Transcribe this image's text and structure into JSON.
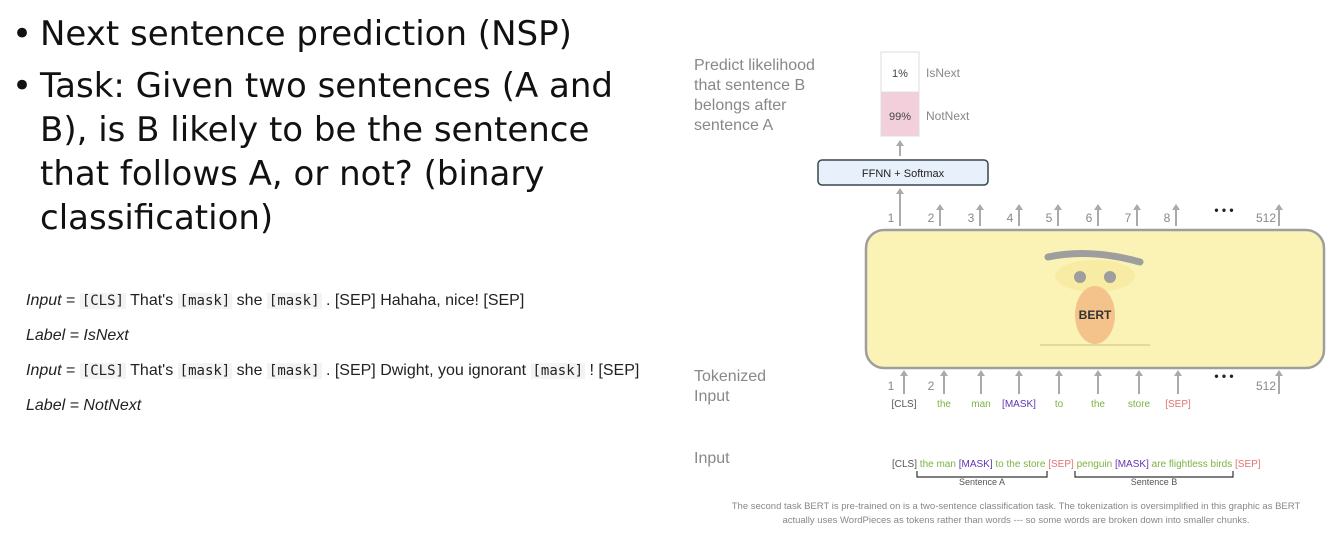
{
  "bullets": [
    "Next sentence prediction (NSP)",
    "Task: Given two sentences (A and B), is B likely to be the sentence that follows A, or not? (binary classification)"
  ],
  "bullet_glyph": "•",
  "examples": [
    {
      "label_a": "Input",
      "eq": " = ",
      "tokens": [
        [
          "m",
          "[CLS]"
        ],
        [
          "t",
          " That's "
        ],
        [
          "m",
          "[mask]"
        ],
        [
          "t",
          " she "
        ],
        [
          "m",
          "[mask]"
        ],
        [
          "t",
          " . [SEP] Hahaha, nice! [SEP]"
        ]
      ]
    },
    {
      "label_a": "Label = IsNext"
    },
    {
      "label_a": "Input",
      "eq": " = ",
      "tokens": [
        [
          "m",
          "[CLS]"
        ],
        [
          "t",
          " That's "
        ],
        [
          "m",
          "[mask]"
        ],
        [
          "t",
          " she "
        ],
        [
          "m",
          "[mask]"
        ],
        [
          "t",
          " . [SEP] Dwight, you ignorant "
        ],
        [
          "m",
          "[mask]"
        ],
        [
          "t",
          " ! [SEP]"
        ]
      ]
    },
    {
      "label_a": "Label = NotNext"
    }
  ],
  "diagram": {
    "predict_label": [
      "Predict likelihood",
      "that sentence B",
      "belongs after",
      "sentence A"
    ],
    "output": [
      {
        "pct": "1%",
        "label": "IsNext"
      },
      {
        "pct": "99%",
        "label": "NotNext"
      }
    ],
    "ffnn_label": "FFNN + Softmax",
    "position_numbers": [
      "1",
      "2",
      "3",
      "4",
      "5",
      "6",
      "7",
      "8",
      "512"
    ],
    "ellipsis": "• • •",
    "model_label": "BERT",
    "tokenized_label": [
      "Tokenized",
      "Input"
    ],
    "input_numbers": [
      "1",
      "2",
      "512"
    ],
    "tokens": [
      {
        "text": "[CLS]",
        "color": "#555555"
      },
      {
        "text": "the",
        "color": "#7cb342"
      },
      {
        "text": "man",
        "color": "#7cb342"
      },
      {
        "text": "[MASK]",
        "color": "#5e35b1"
      },
      {
        "text": "to",
        "color": "#7cb342"
      },
      {
        "text": "the",
        "color": "#7cb342"
      },
      {
        "text": "store",
        "color": "#7cb342"
      },
      {
        "text": "[SEP]",
        "color": "#e57373"
      }
    ],
    "input_label": "Input",
    "input_sentence": [
      {
        "text": "[CLS] ",
        "color": "#555555"
      },
      {
        "text": "the man ",
        "color": "#7cb342"
      },
      {
        "text": "[MASK]",
        "color": "#5e35b1"
      },
      {
        "text": " to the store ",
        "color": "#7cb342"
      },
      {
        "text": "[SEP]",
        "color": "#e57373"
      },
      {
        "text": " penguin ",
        "color": "#7cb342"
      },
      {
        "text": "[MASK]",
        "color": "#5e35b1"
      },
      {
        "text": " are flightless birds ",
        "color": "#7cb342"
      },
      {
        "text": "[SEP]",
        "color": "#e57373"
      }
    ],
    "sentence_a": "Sentence A",
    "sentence_b": "Sentence B",
    "caption": [
      "The second task BERT is pre-trained on is a two-sentence classification task. The tokenization is oversimplified in this graphic as BERT",
      "actually uses WordPieces as tokens rather than words --- so some words are broken down into smaller chunks."
    ],
    "colors": {
      "model_fill": "#fbf3b6",
      "model_stroke": "#9e9e9e",
      "ffnn_fill": "#e8f0fb",
      "ffnn_stroke": "#37474f",
      "notnext_fill": "#f3cfdc",
      "face": "#f4c28b",
      "brow": "#9e9e9e",
      "arrow": "#aaaaaa",
      "grey_text": "#888888"
    }
  }
}
